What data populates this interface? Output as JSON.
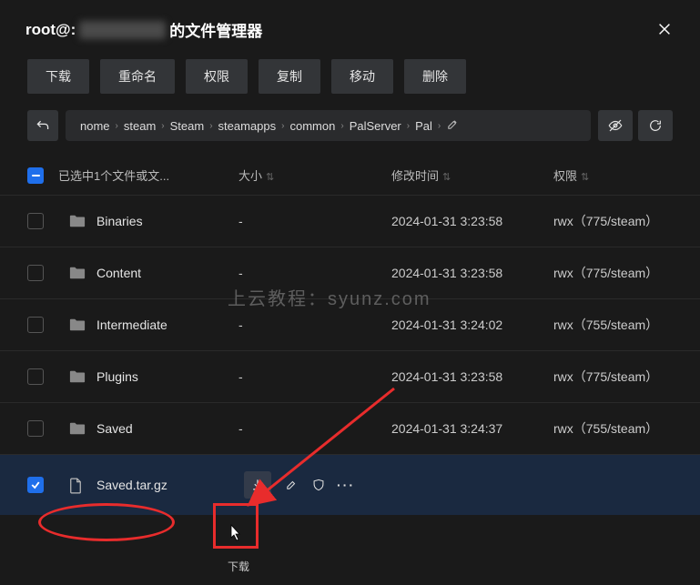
{
  "header": {
    "title_prefix": "root@:",
    "title_suffix": "的文件管理器"
  },
  "toolbar": {
    "download": "下载",
    "rename": "重命名",
    "permissions": "权限",
    "copy": "复制",
    "move": "移动",
    "delete": "删除"
  },
  "breadcrumb": [
    "nome",
    "steam",
    "Steam",
    "steamapps",
    "common",
    "PalServer",
    "Pal"
  ],
  "columns": {
    "selected_label": "已选中1个文件或文...",
    "size": "大小",
    "mtime": "修改时间",
    "perm": "权限"
  },
  "rows": [
    {
      "type": "folder",
      "name": "Binaries",
      "size": "-",
      "mtime": "2024-01-31 3:23:58",
      "perm": "rwx（775/steam）",
      "checked": false
    },
    {
      "type": "folder",
      "name": "Content",
      "size": "-",
      "mtime": "2024-01-31 3:23:58",
      "perm": "rwx（775/steam）",
      "checked": false
    },
    {
      "type": "folder",
      "name": "Intermediate",
      "size": "-",
      "mtime": "2024-01-31 3:24:02",
      "perm": "rwx（755/steam）",
      "checked": false
    },
    {
      "type": "folder",
      "name": "Plugins",
      "size": "-",
      "mtime": "2024-01-31 3:23:58",
      "perm": "rwx（775/steam）",
      "checked": false
    },
    {
      "type": "folder",
      "name": "Saved",
      "size": "-",
      "mtime": "2024-01-31 3:24:37",
      "perm": "rwx（755/steam）",
      "checked": false
    },
    {
      "type": "file",
      "name": "Saved.tar.gz",
      "size": "",
      "mtime": "",
      "perm": "",
      "checked": true
    }
  ],
  "row_actions_tooltip": "下载",
  "watermark": "上云教程：syunz.com"
}
